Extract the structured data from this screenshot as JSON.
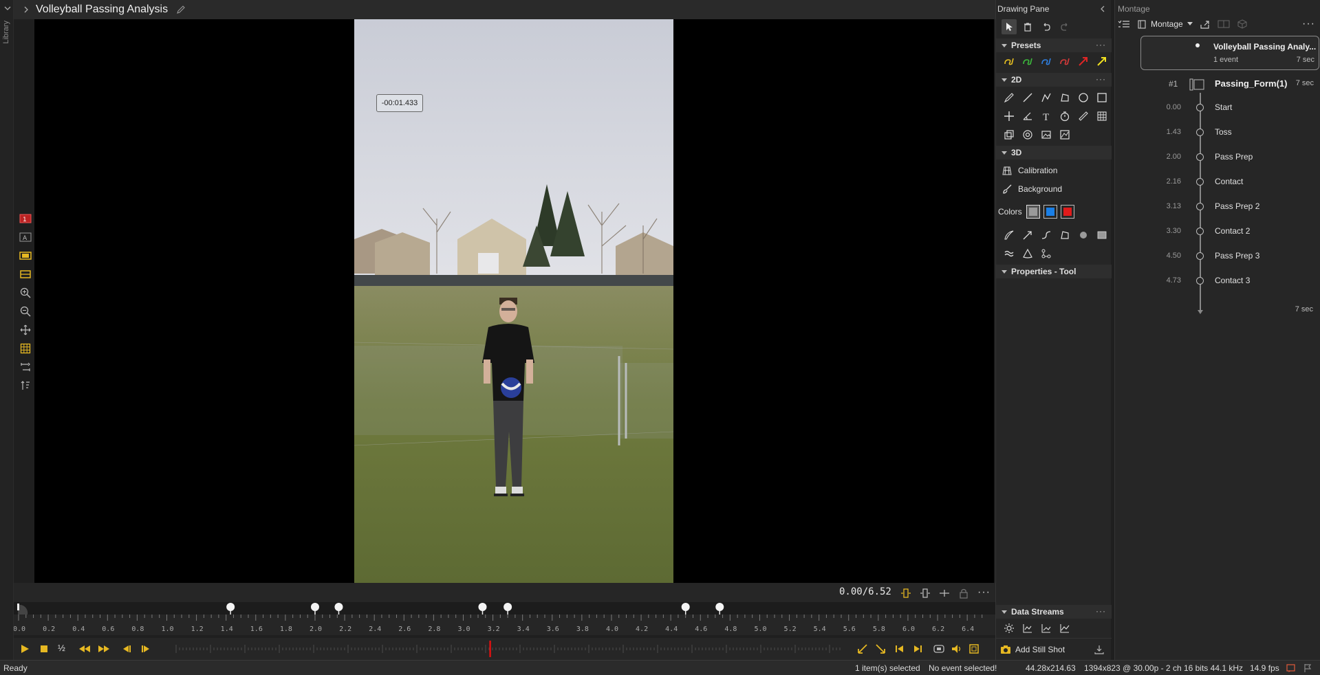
{
  "library": {
    "label": "Library"
  },
  "title": {
    "text": "Volleyball Passing Analysis"
  },
  "video": {
    "time_label": "-00:01.433",
    "readout": "0.00/6.52"
  },
  "timeline": {
    "ruler_ticks": [
      "0.0",
      "0.2",
      "0.4",
      "0.6",
      "0.8",
      "1.0",
      "1.2",
      "1.4",
      "1.6",
      "1.8",
      "2.0",
      "2.2",
      "2.4",
      "2.6",
      "2.8",
      "3.0",
      "3.2",
      "3.4",
      "3.6",
      "3.8",
      "4.0",
      "4.2",
      "4.4",
      "4.6",
      "4.8",
      "5.0",
      "5.2",
      "5.4",
      "5.6",
      "5.8",
      "6.0",
      "6.2",
      "6.4"
    ],
    "ruler_max": 6.52,
    "marker_times": [
      1.43,
      2.0,
      2.16,
      3.13,
      3.3,
      4.5,
      4.73
    ],
    "playhead": 3.25,
    "half_speed": "½",
    "add_still_shot": "Add Still Shot"
  },
  "status": {
    "ready": "Ready",
    "selection": "1 item(s) selected",
    "event": "No event selected!",
    "coords": "44.28x214.63",
    "media_info": "1394x823 @ 30.00p - 2 ch 16 bits 44.1 kHz",
    "fps": "14.9 fps"
  },
  "drawing_pane": {
    "title": "Drawing Pane",
    "presets_label": "Presets",
    "section_2d": "2D",
    "section_3d": "3D",
    "calibration": "Calibration",
    "background": "Background",
    "colors_label": "Colors",
    "properties_label": "Properties - Tool",
    "data_streams_label": "Data Streams",
    "preset_colors": [
      "#e8c020",
      "#3cba3c",
      "#2f7fe0",
      "#d83a3a"
    ],
    "color_swatches": [
      "#9a9a9a",
      "#1a7fe6",
      "#e01b1b"
    ]
  },
  "montage": {
    "title": "Montage",
    "dropdown": "Montage",
    "project_name": "Volleyball Passing Analy...",
    "project_events": "1 event",
    "project_duration": "7 sec",
    "clip_index": "#1",
    "clip_name": "Passing_Form(1)",
    "clip_duration": "7 sec",
    "events": [
      {
        "time": "0.00",
        "name": "Start"
      },
      {
        "time": "1.43",
        "name": "Toss"
      },
      {
        "time": "2.00",
        "name": "Pass Prep"
      },
      {
        "time": "2.16",
        "name": "Contact"
      },
      {
        "time": "3.13",
        "name": "Pass Prep 2"
      },
      {
        "time": "3.30",
        "name": "Contact 2"
      },
      {
        "time": "4.50",
        "name": "Pass Prep 3"
      },
      {
        "time": "4.73",
        "name": "Contact 3"
      }
    ],
    "end_duration": "7 sec"
  }
}
